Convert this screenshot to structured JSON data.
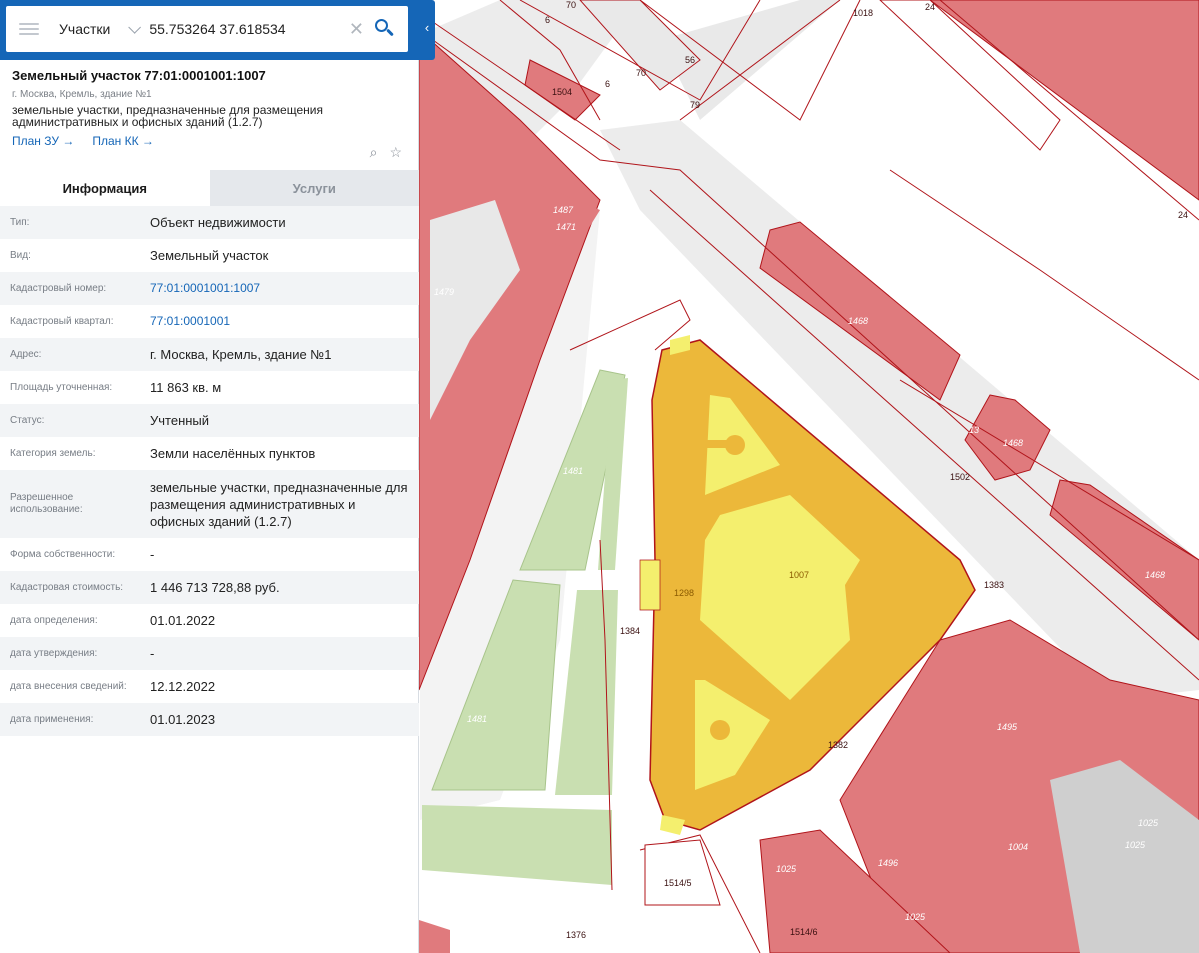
{
  "search": {
    "layer": "Участки",
    "query": "55.753264 37.618534",
    "clear_icon": "close-icon",
    "search_icon": "search-icon",
    "collapse_icon": "chevron-left-icon"
  },
  "card": {
    "title": "Земельный участок 77:01:0001001:1007",
    "address": "г. Москва, Кремль, здание №1",
    "use": "земельные участки, предназначенные для размещения административных и офисных зданий (1.2.7)",
    "link_plan_zu": "План ЗУ →",
    "link_plan_kk": "План КК →",
    "icons": [
      "search-document-icon",
      "star-icon"
    ]
  },
  "tabs": [
    {
      "label": "Информация",
      "active": true
    },
    {
      "label": "Услуги",
      "active": false
    }
  ],
  "info": [
    {
      "key": "Тип:",
      "value": "Объект недвижимости"
    },
    {
      "key": "Вид:",
      "value": "Земельный участок"
    },
    {
      "key": "Кадастровый номер:",
      "value": "77:01:0001001:1007",
      "link": true
    },
    {
      "key": "Кадастровый квартал:",
      "value": "77:01:0001001",
      "link": true
    },
    {
      "key": "Адрес:",
      "value": "г. Москва, Кремль, здание №1"
    },
    {
      "key": "Площадь уточненная:",
      "value": "11 863 кв. м"
    },
    {
      "key": "Статус:",
      "value": "Учтенный"
    },
    {
      "key": "Категория земель:",
      "value": "Земли населённых пунктов"
    },
    {
      "key": "Разрешенное использование:",
      "value": "земельные участки, предназначенные для размещения административных и офисных зданий (1.2.7)"
    },
    {
      "key": "Форма собственности:",
      "value": "-"
    },
    {
      "key": "Кадастровая стоимость:",
      "value": "1 446 713 728,88 руб."
    },
    {
      "key": "дата определения:",
      "value": "01.01.2022"
    },
    {
      "key": "дата утверждения:",
      "value": "-"
    },
    {
      "key": "дата внесения сведений:",
      "value": "12.12.2022"
    },
    {
      "key": "дата применения:",
      "value": "01.01.2023"
    }
  ],
  "map": {
    "colors": {
      "building": "#e07a7d",
      "selected": "#ecb83a",
      "selected_inner": "#f4ef6e",
      "green": "#c9dfb1",
      "road": "#f0f0f0",
      "boundary": "#b0141a"
    },
    "labels": [
      "6",
      "70",
      "56",
      "1018",
      "24",
      "1504",
      "6",
      "70",
      "79",
      "24",
      "1487",
      "1471",
      "1479",
      "1468",
      "13",
      "1468",
      "1502",
      "1481",
      "1007",
      "1298",
      "1383",
      "1468",
      "1384",
      "1481",
      "1382",
      "1495",
      "1025",
      "1004",
      "1025",
      "1496",
      "1025",
      "1514/5",
      "1025",
      "1376",
      "1514/6"
    ]
  }
}
